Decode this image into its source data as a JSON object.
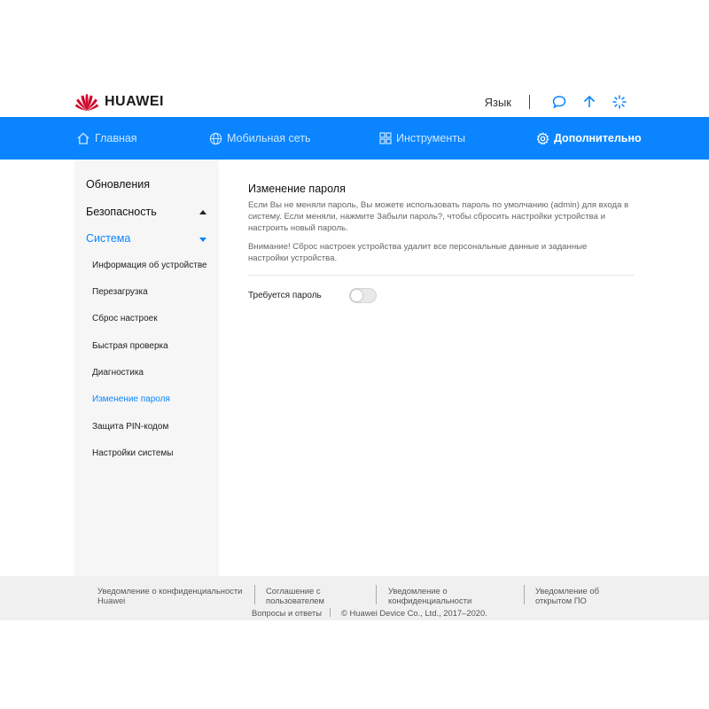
{
  "brand": {
    "name": "HUAWEI",
    "color": "#cf0a2c"
  },
  "header": {
    "language": "Язык",
    "icons": [
      "chat-icon",
      "upload-arrow-icon",
      "loading-spinner-icon"
    ]
  },
  "nav": {
    "accent": "#0a85ff",
    "items": [
      {
        "label": "Главная",
        "icon": "home-icon"
      },
      {
        "label": "Мобильная сеть",
        "icon": "globe-icon"
      },
      {
        "label": "Инструменты",
        "icon": "grid-icon"
      },
      {
        "label": "Дополнительно",
        "icon": "gear-icon"
      }
    ],
    "active": "Дополнительно"
  },
  "sidebar": {
    "sections": [
      {
        "label": "Обновления"
      },
      {
        "label": "Безопасность"
      },
      {
        "label": "Система"
      }
    ],
    "subitems": [
      {
        "label": "Информация об устройстве"
      },
      {
        "label": "Перезагрузка"
      },
      {
        "label": "Сброс настроек"
      },
      {
        "label": "Быстрая проверка"
      },
      {
        "label": "Диагностика"
      },
      {
        "label": "Изменение пароля"
      },
      {
        "label": "Защита PIN-кодом"
      },
      {
        "label": "Настройки системы"
      }
    ],
    "active_subitem": "Изменение пароля"
  },
  "main": {
    "title": "Изменение пароля",
    "paragraph1": "Если Вы не меняли пароль, Вы можете использовать пароль по умолчанию (admin) для входа в систему. Если меняли, нажмите Забыли пароль?, чтобы сбросить настройки устройства и настроить новый пароль.",
    "paragraph2": "Внимание! Сброс настроек устройства удалит все персональные данные и заданные настройки устройства.",
    "toggle_label": "Требуется пароль",
    "toggle_on": false
  },
  "footer": {
    "links": [
      "Уведомление о конфиденциальности Huawei",
      "Соглашение с пользователем",
      "Уведомление о конфиденциальности",
      "Уведомление об открытом ПО"
    ],
    "faq": "Вопросы и ответы",
    "copyright": "© Huawei Device Co., Ltd., 2017–2020."
  }
}
